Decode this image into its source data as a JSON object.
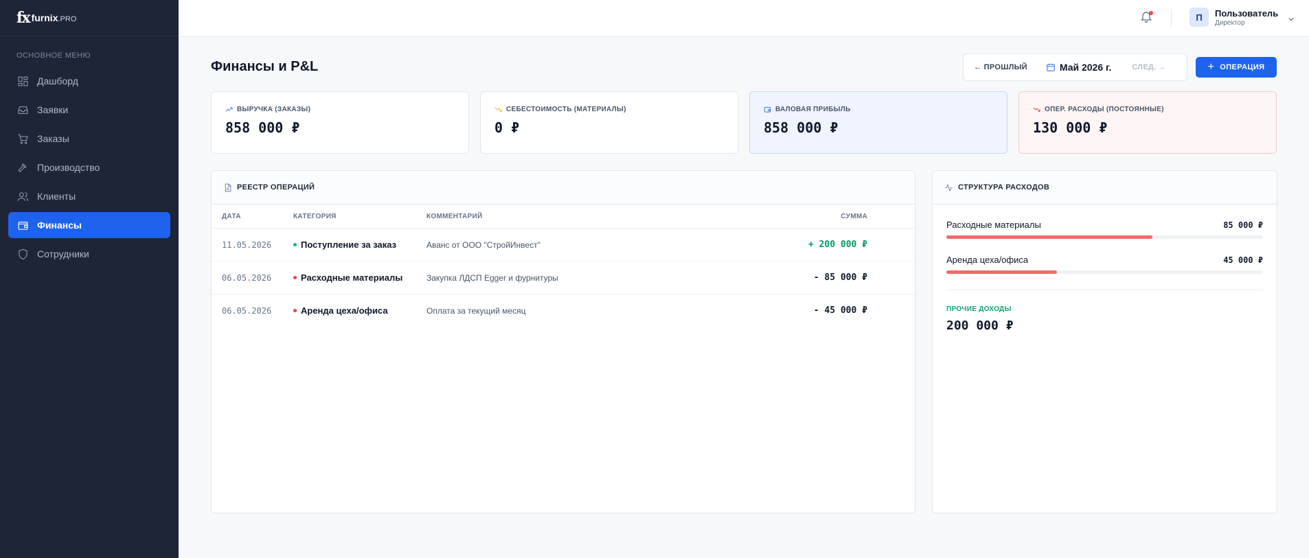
{
  "brand": {
    "mark": "fx",
    "name": "furnix",
    "suffix": ".PRO"
  },
  "sidebar": {
    "section_title": "ОСНОВНОЕ МЕНЮ",
    "items": [
      {
        "label": "Дашборд",
        "icon": "dashboard-icon"
      },
      {
        "label": "Заявки",
        "icon": "inbox-icon"
      },
      {
        "label": "Заказы",
        "icon": "cart-icon"
      },
      {
        "label": "Производство",
        "icon": "hammer-icon"
      },
      {
        "label": "Клиенты",
        "icon": "users-icon"
      },
      {
        "label": "Финансы",
        "icon": "wallet-icon",
        "active": true
      },
      {
        "label": "Сотрудники",
        "icon": "shield-icon"
      }
    ]
  },
  "topbar": {
    "user": {
      "initial": "П",
      "name": "Пользователь",
      "role": "Директор"
    }
  },
  "page": {
    "title": "Финансы и P&L",
    "period": {
      "prev": "ПРОШЛЫЙ",
      "current": "Май 2026 г.",
      "next": "СЛЕД."
    },
    "add_button": "ОПЕРАЦИЯ"
  },
  "kpis": [
    {
      "label": "ВЫРУЧКА (ЗАКАЗЫ)",
      "value": "858 000 ₽",
      "color": "#0f172a",
      "label_color": "#475569",
      "icon": "trend-up-icon",
      "icon_color": "#2563eb"
    },
    {
      "label": "СЕБЕСТОИМОСТЬ (МАТЕРИАЛЫ)",
      "value": "0 ₽",
      "color": "#0f172a",
      "label_color": "#475569",
      "icon": "trend-down-icon",
      "icon_color": "#f59e0b"
    },
    {
      "label": "ВАЛОВАЯ ПРИБЫЛЬ",
      "value": "858 000 ₽",
      "color": "#1e3a8a",
      "label_color": "#1d4ed8",
      "icon": "wallet-icon",
      "icon_color": "#2563eb"
    },
    {
      "label": "ОПЕР. РАСХОДЫ (ПОСТОЯННЫЕ)",
      "value": "130 000 ₽",
      "color": "#b91c1c",
      "label_color": "#b91c1c",
      "icon": "trend-down-icon",
      "icon_color": "#dc2626"
    }
  ],
  "ledger": {
    "title": "РЕЕСТР ОПЕРАЦИЙ",
    "columns": {
      "date": "ДАТА",
      "category": "КАТЕГОРИЯ",
      "comment": "КОММЕНТАРИЙ",
      "amount": "СУММА"
    },
    "rows": [
      {
        "date": "11.05.2026",
        "category": "Поступление за заказ",
        "comment": "Аванс от ООО \"СтройИнвест\"",
        "amount": "+ 200 000 ₽",
        "dot_color": "#10b981",
        "amount_color": "#059669"
      },
      {
        "date": "06.05.2026",
        "category": "Расходные материалы",
        "comment": "Закупка ЛДСП Egger и фурнитуры",
        "amount": "- 85 000 ₽",
        "dot_color": "#ef4444",
        "amount_color": "#0f172a"
      },
      {
        "date": "06.05.2026",
        "category": "Аренда цеха/офиса",
        "comment": "Оплата за текущий месяц",
        "amount": "- 45 000 ₽",
        "dot_color": "#ef4444",
        "amount_color": "#0f172a"
      }
    ]
  },
  "structure": {
    "title": "СТРУКТУРА РАСХОДОВ",
    "items": [
      {
        "label": "Расходные материалы",
        "value": "85 000 ₽",
        "fraction": 0.65
      },
      {
        "label": "Аренда цеха/офиса",
        "value": "45 000 ₽",
        "fraction": 0.35
      }
    ],
    "other_label": "ПРОЧИЕ ДОХОДЫ",
    "other_value": "200 000 ₽"
  }
}
